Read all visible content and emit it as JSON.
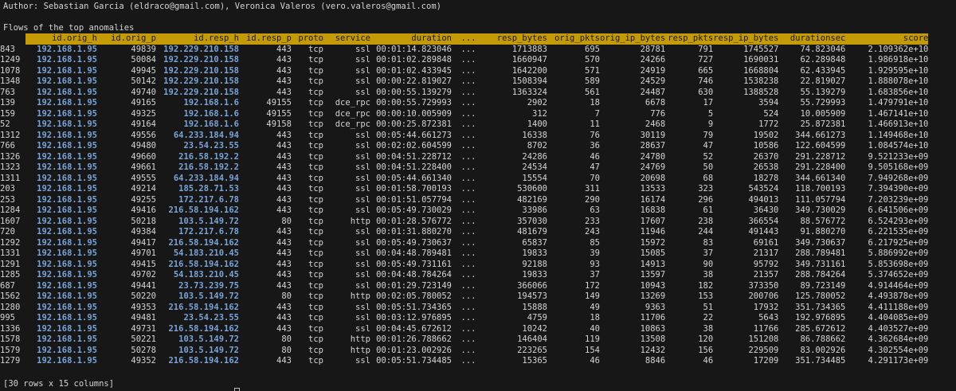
{
  "author_line": "Author: Sebastian Garcia (eldraco@gmail.com), Veronica Valeros (vero.valeros@gmail.com)",
  "flows_title": "Flows of the top anomalies",
  "footer": "[30 rows x 15 columns]",
  "columns": [
    "id.orig_h",
    "id.orig_p",
    "id.resp_h",
    "id.resp_p",
    "proto",
    "service",
    "duration",
    "...",
    "resp_bytes",
    "orig_pkts",
    "orig_ip_bytes",
    "resp_pkts",
    "resp_ip_bytes",
    "durationsec",
    "score"
  ],
  "rows": [
    [
      "843",
      "192.168.1.95",
      "49839",
      "192.229.210.158",
      "443",
      "tcp",
      "ssl",
      "00:01:14.823046",
      "...",
      "1713883",
      "695",
      "28781",
      "791",
      "1745527",
      "74.823046",
      "2.109362e+10"
    ],
    [
      "1249",
      "192.168.1.95",
      "50084",
      "192.229.210.158",
      "443",
      "tcp",
      "ssl",
      "00:01:02.289848",
      "...",
      "1660947",
      "570",
      "24266",
      "727",
      "1690031",
      "62.289848",
      "1.986918e+10"
    ],
    [
      "1078",
      "192.168.1.95",
      "49945",
      "192.229.210.158",
      "443",
      "tcp",
      "ssl",
      "00:01:02.433945",
      "...",
      "1642200",
      "571",
      "24919",
      "665",
      "1668804",
      "62.433945",
      "1.929595e+10"
    ],
    [
      "1348",
      "192.168.1.95",
      "50142",
      "192.229.210.158",
      "443",
      "tcp",
      "ssl",
      "00:00:22.819027",
      "...",
      "1508394",
      "589",
      "24529",
      "746",
      "1538238",
      "22.819027",
      "1.888078e+10"
    ],
    [
      "763",
      "192.168.1.95",
      "49740",
      "192.229.210.158",
      "443",
      "tcp",
      "ssl",
      "00:00:55.139279",
      "...",
      "1363324",
      "561",
      "24487",
      "630",
      "1388528",
      "55.139279",
      "1.683856e+10"
    ],
    [
      "139",
      "192.168.1.95",
      "49165",
      "192.168.1.6",
      "49155",
      "tcp",
      "dce_rpc",
      "00:00:55.729993",
      "...",
      "2902",
      "18",
      "6678",
      "17",
      "3594",
      "55.729993",
      "1.479791e+10"
    ],
    [
      "159",
      "192.168.1.95",
      "49325",
      "192.168.1.6",
      "49155",
      "tcp",
      "dce_rpc",
      "00:00:10.005909",
      "...",
      "312",
      "7",
      "776",
      "5",
      "524",
      "10.005909",
      "1.467141e+10"
    ],
    [
      "52",
      "192.168.1.95",
      "49164",
      "192.168.1.6",
      "49158",
      "tcp",
      "dce_rpc",
      "00:00:25.872381",
      "...",
      "1400",
      "11",
      "2468",
      "9",
      "1772",
      "25.872381",
      "1.466913e+10"
    ],
    [
      "1312",
      "192.168.1.95",
      "49556",
      "64.233.184.94",
      "443",
      "tcp",
      "ssl",
      "00:05:44.661273",
      "...",
      "16338",
      "76",
      "30119",
      "79",
      "19502",
      "344.661273",
      "1.149468e+10"
    ],
    [
      "766",
      "192.168.1.95",
      "49480",
      "23.54.23.55",
      "443",
      "tcp",
      "ssl",
      "00:02:02.604599",
      "...",
      "8702",
      "36",
      "28637",
      "47",
      "10586",
      "122.604599",
      "1.084574e+10"
    ],
    [
      "1326",
      "192.168.1.95",
      "49660",
      "216.58.192.2",
      "443",
      "tcp",
      "ssl",
      "00:04:51.228712",
      "...",
      "24286",
      "46",
      "24780",
      "52",
      "26370",
      "291.228712",
      "9.521233e+09"
    ],
    [
      "1323",
      "192.168.1.95",
      "49661",
      "216.58.192.2",
      "443",
      "tcp",
      "ssl",
      "00:04:51.228400",
      "...",
      "24534",
      "47",
      "24769",
      "50",
      "26538",
      "291.228400",
      "9.505168e+09"
    ],
    [
      "1311",
      "192.168.1.95",
      "49555",
      "64.233.184.94",
      "443",
      "tcp",
      "ssl",
      "00:05:44.661340",
      "...",
      "15554",
      "70",
      "20698",
      "68",
      "18278",
      "344.661340",
      "7.949268e+09"
    ],
    [
      "203",
      "192.168.1.95",
      "49214",
      "185.28.71.53",
      "443",
      "tcp",
      "ssl",
      "00:01:58.700193",
      "...",
      "530600",
      "311",
      "13533",
      "323",
      "543524",
      "118.700193",
      "7.394390e+09"
    ],
    [
      "253",
      "192.168.1.95",
      "49255",
      "172.217.6.78",
      "443",
      "tcp",
      "ssl",
      "00:01:51.057794",
      "...",
      "482169",
      "290",
      "16174",
      "296",
      "494013",
      "111.057794",
      "7.203239e+09"
    ],
    [
      "1284",
      "192.168.1.95",
      "49416",
      "216.58.194.162",
      "443",
      "tcp",
      "ssl",
      "00:05:49.730029",
      "...",
      "33986",
      "63",
      "16838",
      "61",
      "36430",
      "349.730029",
      "6.641506e+09"
    ],
    [
      "1607",
      "192.168.1.95",
      "50218",
      "103.5.149.72",
      "80",
      "tcp",
      "http",
      "00:01:28.576772",
      "...",
      "357030",
      "233",
      "17607",
      "238",
      "366554",
      "88.576772",
      "6.524293e+09"
    ],
    [
      "720",
      "192.168.1.95",
      "49384",
      "172.217.6.78",
      "443",
      "tcp",
      "ssl",
      "00:01:31.880270",
      "...",
      "481679",
      "243",
      "11946",
      "244",
      "491443",
      "91.880270",
      "6.221535e+09"
    ],
    [
      "1292",
      "192.168.1.95",
      "49417",
      "216.58.194.162",
      "443",
      "tcp",
      "ssl",
      "00:05:49.730637",
      "...",
      "65837",
      "85",
      "15972",
      "83",
      "69161",
      "349.730637",
      "6.217925e+09"
    ],
    [
      "1331",
      "192.168.1.95",
      "49701",
      "54.183.210.45",
      "443",
      "tcp",
      "ssl",
      "00:04:48.789481",
      "...",
      "19833",
      "39",
      "15085",
      "37",
      "21317",
      "288.789481",
      "5.886992e+09"
    ],
    [
      "1291",
      "192.168.1.95",
      "49415",
      "216.58.194.162",
      "443",
      "tcp",
      "ssl",
      "00:05:49.731161",
      "...",
      "92188",
      "93",
      "14913",
      "90",
      "95792",
      "349.731161",
      "5.853698e+09"
    ],
    [
      "1285",
      "192.168.1.95",
      "49702",
      "54.183.210.45",
      "443",
      "tcp",
      "ssl",
      "00:04:48.784264",
      "...",
      "19833",
      "37",
      "13597",
      "38",
      "21357",
      "288.784264",
      "5.374652e+09"
    ],
    [
      "687",
      "192.168.1.95",
      "49441",
      "23.73.239.75",
      "443",
      "tcp",
      "ssl",
      "00:01:29.723149",
      "...",
      "366066",
      "172",
      "10943",
      "182",
      "373350",
      "89.723149",
      "4.914464e+09"
    ],
    [
      "1562",
      "192.168.1.95",
      "50220",
      "103.5.149.72",
      "80",
      "tcp",
      "http",
      "00:02:05.780052",
      "...",
      "194573",
      "149",
      "13269",
      "153",
      "200706",
      "125.780052",
      "4.493878e+09"
    ],
    [
      "1280",
      "192.168.1.95",
      "49353",
      "216.58.194.162",
      "443",
      "tcp",
      "ssl",
      "00:05:51.734365",
      "...",
      "15888",
      "49",
      "9363",
      "51",
      "17932",
      "351.734365",
      "4.411188e+09"
    ],
    [
      "995",
      "192.168.1.95",
      "49481",
      "23.54.23.55",
      "443",
      "tcp",
      "ssl",
      "00:03:12.976895",
      "...",
      "4759",
      "18",
      "11706",
      "22",
      "5643",
      "192.976895",
      "4.404085e+09"
    ],
    [
      "1336",
      "192.168.1.95",
      "49731",
      "216.58.194.162",
      "443",
      "tcp",
      "ssl",
      "00:04:45.672612",
      "...",
      "10242",
      "40",
      "10863",
      "38",
      "11766",
      "285.672612",
      "4.403527e+09"
    ],
    [
      "1578",
      "192.168.1.95",
      "50221",
      "103.5.149.72",
      "80",
      "tcp",
      "http",
      "00:01:26.788662",
      "...",
      "146404",
      "119",
      "13508",
      "120",
      "151208",
      "86.788662",
      "4.362684e+09"
    ],
    [
      "1579",
      "192.168.1.95",
      "50278",
      "103.5.149.72",
      "80",
      "tcp",
      "http",
      "00:01:23.002926",
      "...",
      "223265",
      "154",
      "12432",
      "156",
      "229509",
      "83.002926",
      "4.302554e+09"
    ],
    [
      "1279",
      "192.168.1.95",
      "49352",
      "216.58.194.162",
      "443",
      "tcp",
      "ssl",
      "00:05:51.734485",
      "...",
      "15365",
      "46",
      "8846",
      "46",
      "17209",
      "351.734485",
      "4.291173e+09"
    ]
  ]
}
